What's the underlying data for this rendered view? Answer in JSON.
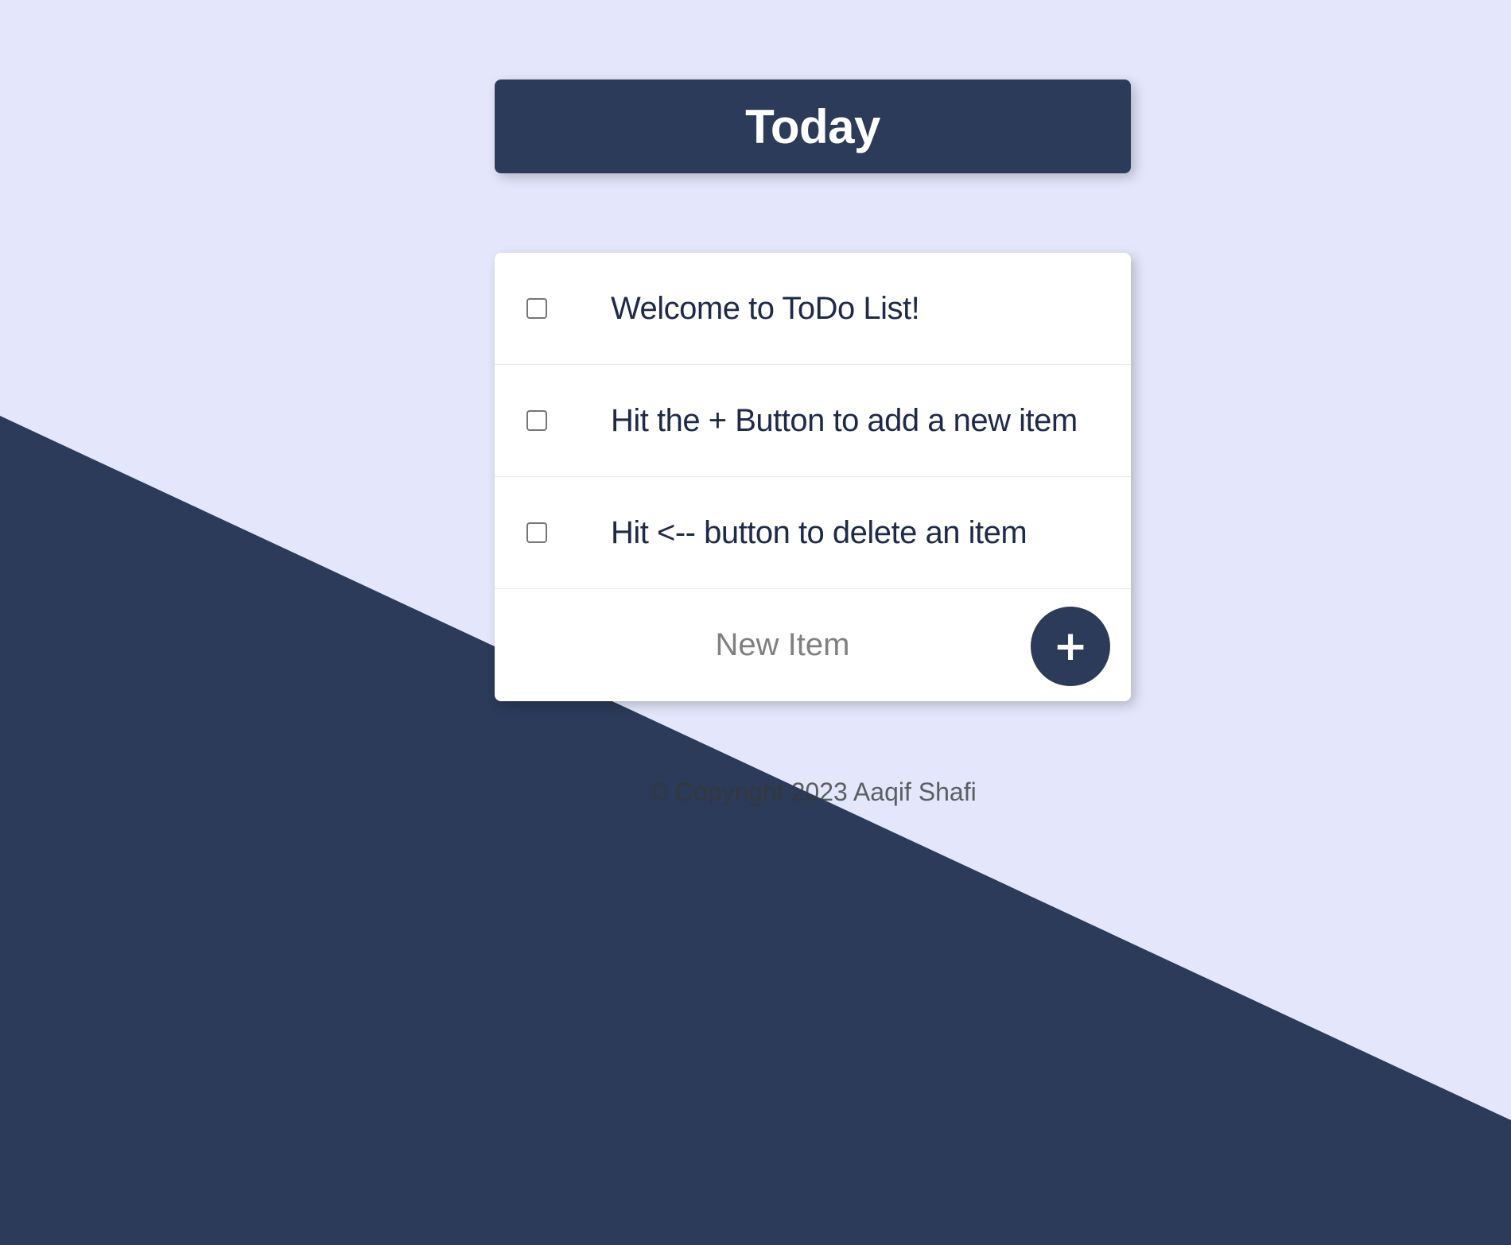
{
  "colors": {
    "background": "#E4E7FB",
    "accent": "#2B3B59",
    "card": "#FFFFFF",
    "item_text": "#1E2A4A"
  },
  "header": {
    "title": "Today"
  },
  "list": {
    "items": [
      {
        "label": "Welcome to ToDo List!",
        "checked": false
      },
      {
        "label": "Hit the + Button to add a new item",
        "checked": false
      },
      {
        "label": "Hit <-- button to delete an item",
        "checked": false
      }
    ],
    "new_item": {
      "placeholder": "New Item",
      "value": ""
    },
    "add_button_label": "+"
  },
  "footer": {
    "text": "© Copyright 2023 Aaqif Shafi"
  }
}
